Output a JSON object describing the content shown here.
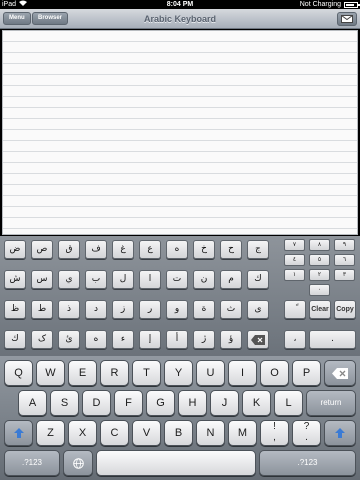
{
  "status": {
    "carrier": "iPad",
    "time": "8:04 PM",
    "charging": "Not Charging"
  },
  "nav": {
    "menu_label": "Menu",
    "browser_label": "Browser",
    "title": "Arabic Keyboard"
  },
  "arabic_rows": [
    [
      "ض",
      "ص",
      "ق",
      "ف",
      "غ",
      "ع",
      "ه",
      "خ",
      "ح",
      "ج"
    ],
    [
      "ش",
      "س",
      "ي",
      "ب",
      "ل",
      "ا",
      "ت",
      "ن",
      "م",
      "ك"
    ],
    [
      "ظ",
      "ط",
      "ذ",
      "د",
      "ز",
      "ر",
      "و",
      "ة",
      "ث",
      "ى"
    ],
    [
      "ك",
      "ک",
      "یٔ",
      "ه",
      "ء",
      "إ",
      "أ",
      "ژ",
      "ؤ",
      "⌫"
    ]
  ],
  "numpad": [
    [
      "٧",
      "٨",
      "٩"
    ],
    [
      "٤",
      "٥",
      "٦"
    ],
    [
      "١",
      "٢",
      "٣"
    ],
    [
      "٠"
    ]
  ],
  "arabic_extra": {
    "hamza": "ً",
    "clear": "Clear",
    "copy": "Copy",
    "comma": "،",
    "dot": "."
  },
  "kb_rows": [
    [
      "Q",
      "W",
      "E",
      "R",
      "T",
      "Y",
      "U",
      "I",
      "O",
      "P"
    ],
    [
      "A",
      "S",
      "D",
      "F",
      "G",
      "H",
      "J",
      "K",
      "L"
    ],
    [
      "Z",
      "X",
      "C",
      "V",
      "B",
      "N",
      "M",
      "!\n,",
      "?\n."
    ]
  ],
  "kb_labels": {
    "return": "return",
    "numbers_left": ".?123",
    "numbers_right": ".?123"
  },
  "icons": {
    "wifi": "wifi-icon",
    "mail": "mail-icon",
    "backspace": "backspace-icon",
    "shift": "shift-icon",
    "globe": "globe-icon"
  }
}
